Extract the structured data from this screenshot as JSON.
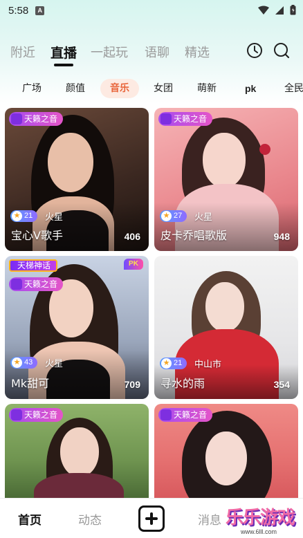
{
  "status_bar": {
    "time": "5:58",
    "notification_letter": "A"
  },
  "top_tabs": [
    "附近",
    "直播",
    "一起玩",
    "语聊",
    "精选"
  ],
  "active_top_tab": "直播",
  "icons": {
    "history": "clock-icon",
    "search": "search-icon"
  },
  "categories": [
    "广场",
    "颜值",
    "音乐",
    "女团",
    "萌新",
    "pk",
    "全民"
  ],
  "active_category": "音乐",
  "cards": [
    {
      "badge": "天籁之音",
      "level": "21",
      "location": "火星",
      "title": "宝心V歌手",
      "count": "406"
    },
    {
      "badge": "天籁之音",
      "level": "27",
      "location": "火星",
      "title": "皮卡乔唱歌版",
      "count": "948"
    },
    {
      "ladder_badge": "天梯神话",
      "pk": "PK",
      "badge": "天籁之音",
      "level": "43",
      "location": "火星",
      "title": "Mk甜可",
      "count": "709"
    },
    {
      "badge": "",
      "level": "21",
      "location": "中山市",
      "title": "寻水的雨",
      "count": "354"
    },
    {
      "badge": "天籁之音"
    },
    {
      "badge": "天籁之音"
    }
  ],
  "bottom_nav": {
    "items": [
      "首页",
      "动态",
      "消息"
    ],
    "active": "首页"
  },
  "watermark": {
    "text": "乐乐游戏",
    "url": "www.6lll.com"
  },
  "colors": {
    "accent": "#e8643a",
    "badge_purple": "#a64cf0"
  }
}
